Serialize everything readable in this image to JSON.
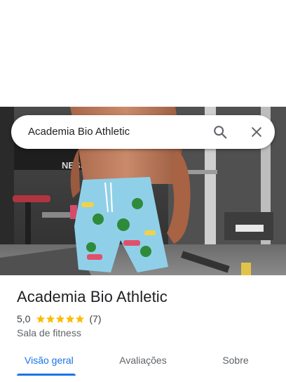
{
  "search": {
    "query": "Academia Bio Athletic"
  },
  "place": {
    "name": "Academia Bio Athletic",
    "rating": "5,0",
    "stars": 5,
    "review_count": "(7)",
    "category": "Sala de fitness"
  },
  "tabs": [
    {
      "label": "Visão geral",
      "active": true
    },
    {
      "label": "Avaliações",
      "active": false
    },
    {
      "label": "Sobre",
      "active": false
    }
  ],
  "colors": {
    "accent": "#1a73e8",
    "star": "#fbbc04"
  },
  "icons": [
    "search-icon",
    "close-icon",
    "star-icon"
  ]
}
